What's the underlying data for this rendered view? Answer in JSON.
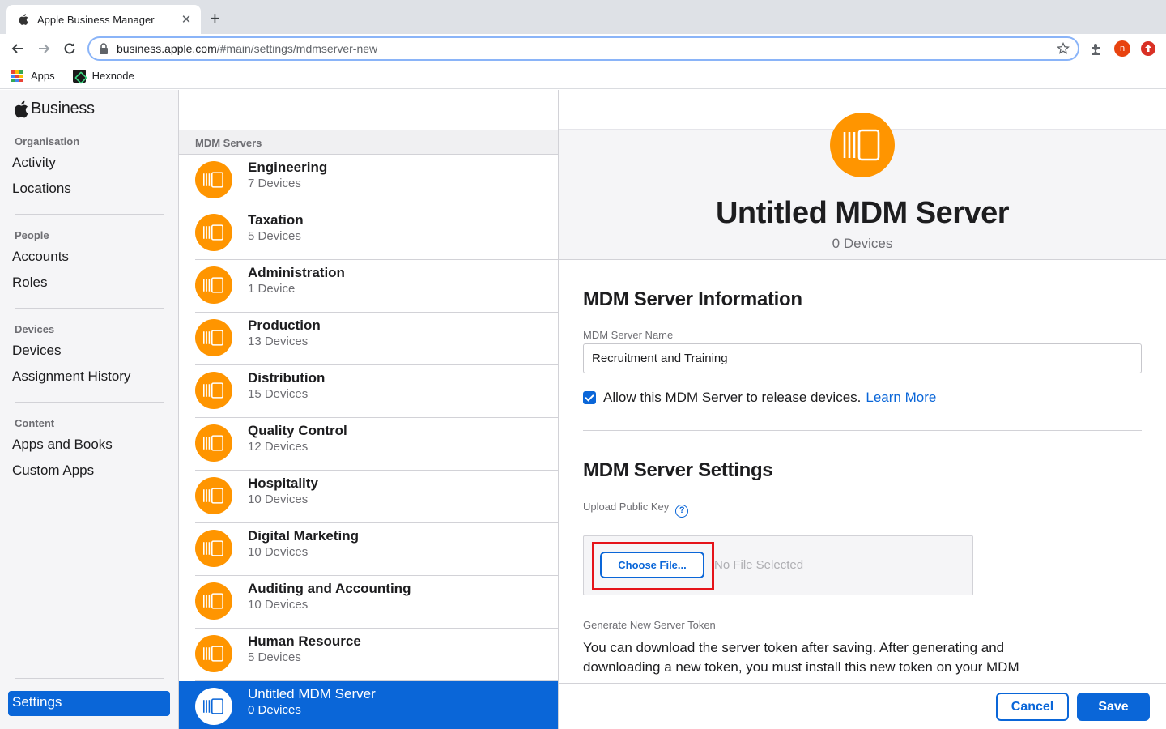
{
  "browser": {
    "tab_title": "Apple Business Manager",
    "url_host": "business.apple.com",
    "url_path": "/#main/settings/mdmserver-new",
    "avatar_letter": "n",
    "bookmarks": [
      {
        "label": "Apps",
        "icon": "apps-grid-icon"
      },
      {
        "label": "Hexnode",
        "icon": "hexnode-icon"
      }
    ]
  },
  "sidebar": {
    "brand": "Business",
    "sections": [
      {
        "title": "Organisation",
        "items": [
          "Activity",
          "Locations"
        ]
      },
      {
        "title": "People",
        "items": [
          "Accounts",
          "Roles"
        ]
      },
      {
        "title": "Devices",
        "items": [
          "Devices",
          "Assignment History"
        ]
      },
      {
        "title": "Content",
        "items": [
          "Apps and Books",
          "Custom Apps"
        ]
      }
    ],
    "settings_label": "Settings"
  },
  "list": {
    "header": "MDM Servers",
    "servers": [
      {
        "name": "Engineering",
        "count": "7 Devices"
      },
      {
        "name": "Taxation",
        "count": "5 Devices"
      },
      {
        "name": "Administration",
        "count": "1 Device"
      },
      {
        "name": "Production",
        "count": "13 Devices"
      },
      {
        "name": "Distribution",
        "count": "15 Devices"
      },
      {
        "name": "Quality Control",
        "count": "12 Devices"
      },
      {
        "name": "Hospitality",
        "count": "10 Devices"
      },
      {
        "name": "Digital Marketing",
        "count": "10 Devices"
      },
      {
        "name": "Auditing and Accounting",
        "count": "10 Devices"
      },
      {
        "name": "Human Resource",
        "count": "5 Devices"
      }
    ],
    "selected": {
      "name": "Untitled MDM Server",
      "count": "0 Devices"
    }
  },
  "detail": {
    "title": "Untitled MDM Server",
    "subtitle": "0 Devices",
    "info_heading": "MDM Server Information",
    "name_label": "MDM Server Name",
    "name_value": "Recruitment and Training",
    "release_label": "Allow this MDM Server to release devices.",
    "release_checked": true,
    "learn_more": "Learn More",
    "settings_heading": "MDM Server Settings",
    "upload_label": "Upload Public Key",
    "choose_file": "Choose File...",
    "no_file": "No File Selected",
    "token_label": "Generate New Server Token",
    "token_text": "You can download the server token after saving. After generating and downloading a new token, you must install this new token on your MDM",
    "cancel": "Cancel",
    "save": "Save"
  },
  "colors": {
    "accent": "#0a66d8",
    "server_icon": "#ff9500",
    "highlight": "#e5141a"
  }
}
